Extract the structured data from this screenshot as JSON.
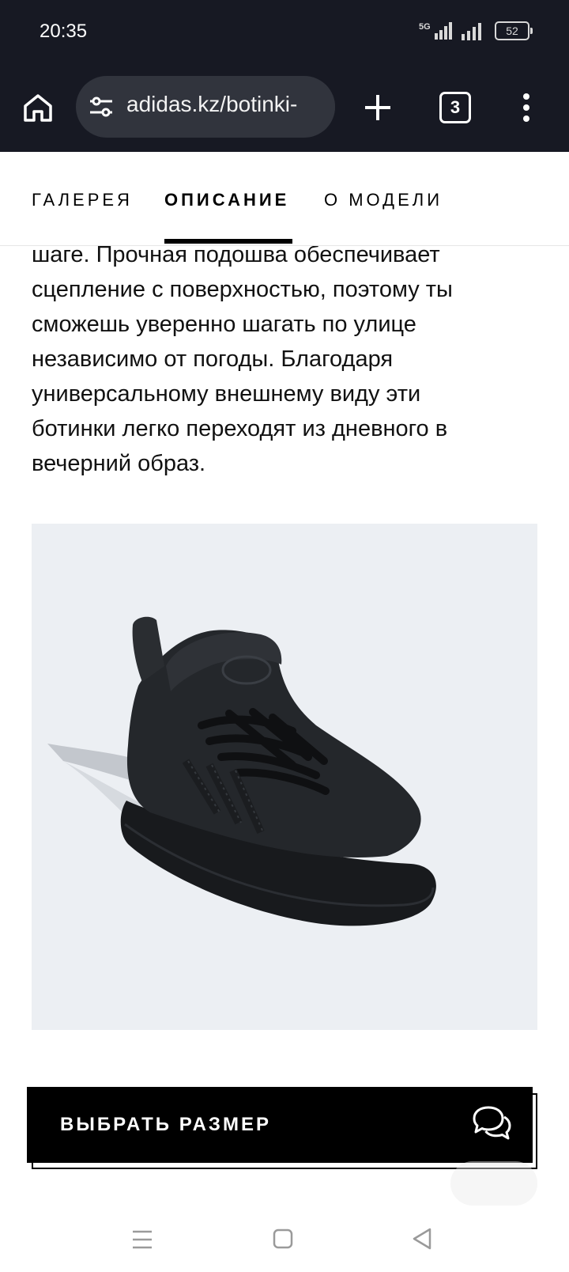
{
  "status_bar": {
    "time": "20:35",
    "network": "5G",
    "battery": "52"
  },
  "browser": {
    "url": "adidas.kz/botinki-",
    "tab_count": "3",
    "icons": [
      "home-icon",
      "site-settings-icon",
      "plus-icon",
      "more-vert-icon"
    ]
  },
  "section_tabs": {
    "items": [
      {
        "label": "ГАЛЕРЕЯ",
        "active": false
      },
      {
        "label": "ОПИСАНИЕ",
        "active": true
      },
      {
        "label": "О МОДЕЛИ",
        "active": false
      }
    ]
  },
  "description": {
    "lines": [
      "шаге. Прочная подошва обеспечивает",
      "сцепление с поверхностью, поэтому ты",
      "сможешь уверенно шагать по улице",
      "независимо от погоды. Благодаря",
      "универсальному внешнему виду эти",
      "ботинки легко переходят из дневного в",
      "вечерний образ."
    ]
  },
  "product_image": {
    "background": "#eceff3",
    "shoe_color": "#1f2226"
  },
  "cta": {
    "label": "ВЫБРАТЬ РАЗМЕР",
    "icon": "chat-icon"
  },
  "colors": {
    "chrome_bg": "#171923",
    "url_pill": "#31343d",
    "accent": "#000000"
  }
}
